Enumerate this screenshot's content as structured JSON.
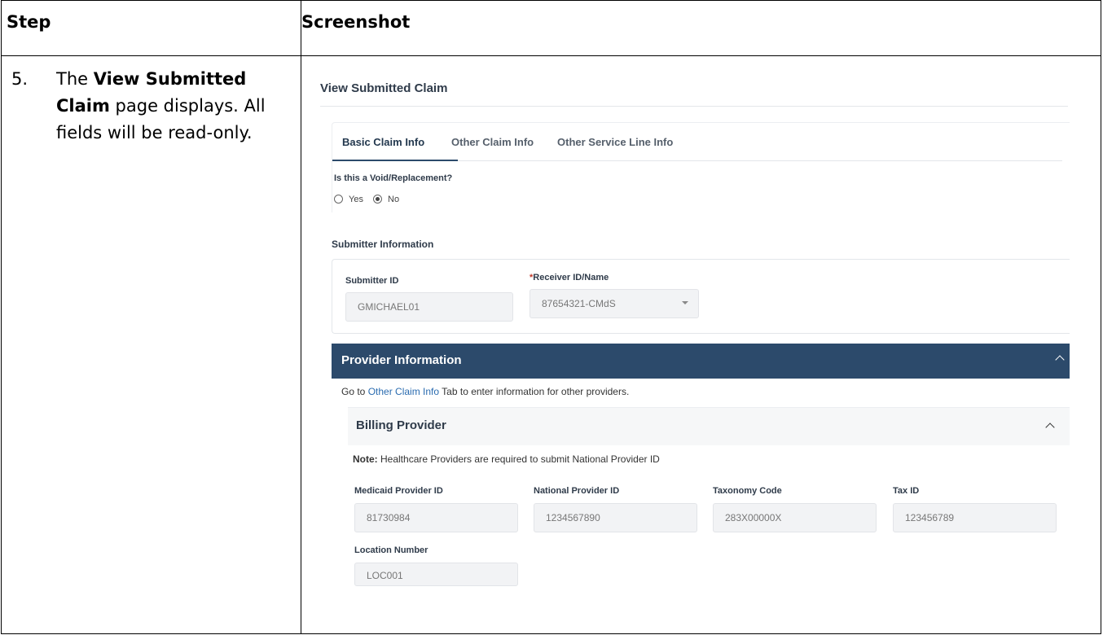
{
  "table": {
    "header_step": "Step",
    "header_screenshot": "Screenshot"
  },
  "step": {
    "number": "5.",
    "text_prefix": "The ",
    "text_bold": "View Submitted Claim",
    "text_suffix": " page displays. All fields will be read-only."
  },
  "screenshot": {
    "page_title": "View Submitted Claim",
    "tabs": [
      "Basic Claim Info",
      "Other Claim Info",
      "Other Service Line Info"
    ],
    "void_question": "Is this a Void/Replacement?",
    "radio_yes": "Yes",
    "radio_no": "No",
    "radio_selected": "No",
    "submitter_section": "Submitter Information",
    "submitter_id_label": "Submitter ID",
    "submitter_id_value": "GMICHAEL01",
    "receiver_required_mark": "*",
    "receiver_label": "Receiver ID/Name",
    "receiver_value": "87654321-CMdS",
    "provider_section": "Provider Information",
    "goto_prefix": "Go to ",
    "goto_link": "Other Claim Info",
    "goto_suffix": " Tab to enter information for other providers.",
    "billing_section": "Billing Provider",
    "note_label": "Note:",
    "note_text": " Healthcare Providers are required to submit National Provider ID",
    "fields": [
      {
        "label": "Medicaid Provider ID",
        "value": "81730984"
      },
      {
        "label": "National Provider ID",
        "value": "1234567890"
      },
      {
        "label": "Taxonomy Code",
        "value": "283X00000X"
      },
      {
        "label": "Tax ID",
        "value": "123456789"
      },
      {
        "label": "Location Number",
        "value": "LOC001"
      }
    ],
    "accent_color": "#2c4a6b"
  }
}
